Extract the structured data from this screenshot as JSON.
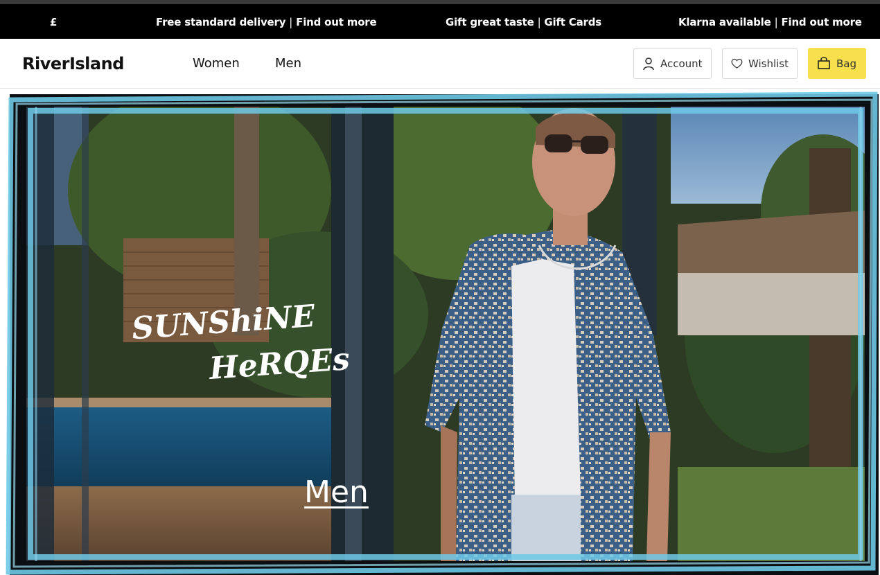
{
  "promo": {
    "currency": "£",
    "items": [
      {
        "text": "Free standard delivery",
        "link": "Find out more"
      },
      {
        "text": "Gift great taste",
        "link": "Gift Cards"
      },
      {
        "text": "Klarna available",
        "link": "Find out more"
      }
    ],
    "separator": "|"
  },
  "header": {
    "logo": "RiverIsland",
    "nav": [
      "Women",
      "Men"
    ],
    "account_label": "Account",
    "wishlist_label": "Wishlist",
    "bag_label": "Bag"
  },
  "hero": {
    "tagline_line1": "SUNShiNE",
    "tagline_line2": "HeRQEs",
    "cta_label": "Men"
  },
  "colors": {
    "promo_bg": "#000000",
    "bag_button": "#f7e04b",
    "frame_chalk": "#6ec9e6"
  }
}
